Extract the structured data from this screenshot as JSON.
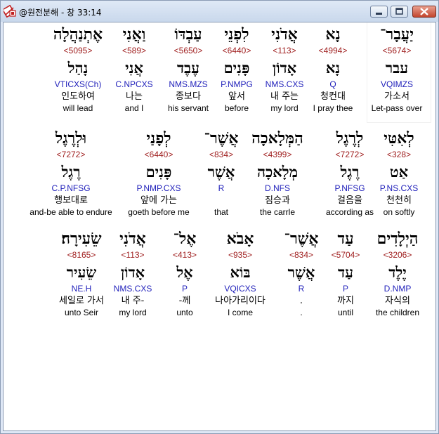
{
  "window": {
    "title": "@원전분해 - 창 33:14"
  },
  "rows": [
    {
      "words": [
        {
          "heb": "יַעֲבָר־",
          "strong": "<5674>",
          "lemma": "עבר",
          "parse": "VQIMZS",
          "kor": "가소서",
          "eng": "Let-pass over",
          "selected": true
        },
        {
          "heb": "נָא",
          "strong": "<4994>",
          "lemma": "נָא",
          "parse": "Q",
          "kor": "청컨대",
          "eng": "I pray thee"
        },
        {
          "heb": "אֲדֹנִי",
          "strong": "<113>",
          "lemma": "אָדוֹן",
          "parse": "NMS.CXS",
          "kor": "내 주는",
          "eng": "my lord"
        },
        {
          "heb": "לִפְנֵי",
          "strong": "<6440>",
          "lemma": "פָּנִים",
          "parse": "P.NMPG",
          "kor": "앞서",
          "eng": "before"
        },
        {
          "heb": "עַבְדּוֹ",
          "strong": "<5650>",
          "lemma": "עֶבֶד",
          "parse": "NMS.MZS",
          "kor": "종보다",
          "eng": "his servant"
        },
        {
          "heb": "וַאֲנִי",
          "strong": "<589>",
          "lemma": "אֲנִי",
          "parse": "C.NPCXS",
          "kor": "나는",
          "eng": "and I"
        },
        {
          "heb": "אֶתְנַהֲלָה",
          "strong": "<5095>",
          "lemma": "נָהַל",
          "parse": "VTICXS(Ch)",
          "kor": "인도하여",
          "eng": "will lead"
        }
      ]
    },
    {
      "words": [
        {
          "heb": "לְאִטִּי",
          "strong": "<328>",
          "lemma": "אַט",
          "parse": "P.NS.CXS",
          "kor": "천천히",
          "eng": "on softly"
        },
        {
          "heb": "לְרֶגֶל",
          "strong": "<7272>",
          "lemma": "רֶגֶל",
          "parse": "P.NFSG",
          "kor": "걸음을",
          "eng": "according as"
        },
        {
          "heb": "הַמְּלָאכָה",
          "strong": "<4399>",
          "lemma": "מְלָאכָה",
          "parse": "D.NFS",
          "kor": "짐승과",
          "eng": "the carrle"
        },
        {
          "heb": "אֲשֶׁר־",
          "strong": "<834>",
          "lemma": "אֲשֶׁר",
          "parse": "R",
          "kor": "",
          "eng": "that"
        },
        {
          "heb": "לְפָנַי",
          "strong": "<6440>",
          "lemma": "פָּנִים",
          "parse": "P.NMP.CXS",
          "kor": "앞에 가는",
          "eng": "goeth before me"
        },
        {
          "heb": "וּלְרֶגֶל",
          "strong": "<7272>",
          "lemma": "רֶגֶל",
          "parse": "C.P.NFSG",
          "kor": "행보대로",
          "eng": "and-be able to endure"
        }
      ]
    },
    {
      "words": [
        {
          "heb": "הַיְלָדִים",
          "strong": "<3206>",
          "lemma": "יֶלֶד",
          "parse": "D.NMP",
          "kor": "자식의",
          "eng": "the children"
        },
        {
          "heb": "עַד",
          "strong": "<5704>",
          "lemma": "עַד",
          "parse": "P",
          "kor": "까지",
          "eng": "until"
        },
        {
          "heb": "אֲשֶׁר־",
          "strong": "<834>",
          "lemma": "אֲשֶׁר",
          "parse": "R",
          "kor": ".",
          "eng": "."
        },
        {
          "heb": "אָבֹא",
          "strong": "<935>",
          "lemma": "בּוֹא",
          "parse": "VQICXS",
          "kor": "나아가리이다",
          "eng": "I come"
        },
        {
          "heb": "אֶל־",
          "strong": "<413>",
          "lemma": "אֶל",
          "parse": "P",
          "kor": "-께",
          "eng": "unto"
        },
        {
          "heb": "אֲדֹנִי",
          "strong": "<113>",
          "lemma": "אָדוֹן",
          "parse": "NMS.CXS",
          "kor": "내 주-",
          "eng": "my lord"
        },
        {
          "heb": "שֵׂעִירָה׃",
          "strong": "<8165>",
          "lemma": "שֵׂעִיר",
          "parse": "NE.H",
          "kor": "세일로 가서",
          "eng": "unto Seir"
        }
      ]
    }
  ]
}
